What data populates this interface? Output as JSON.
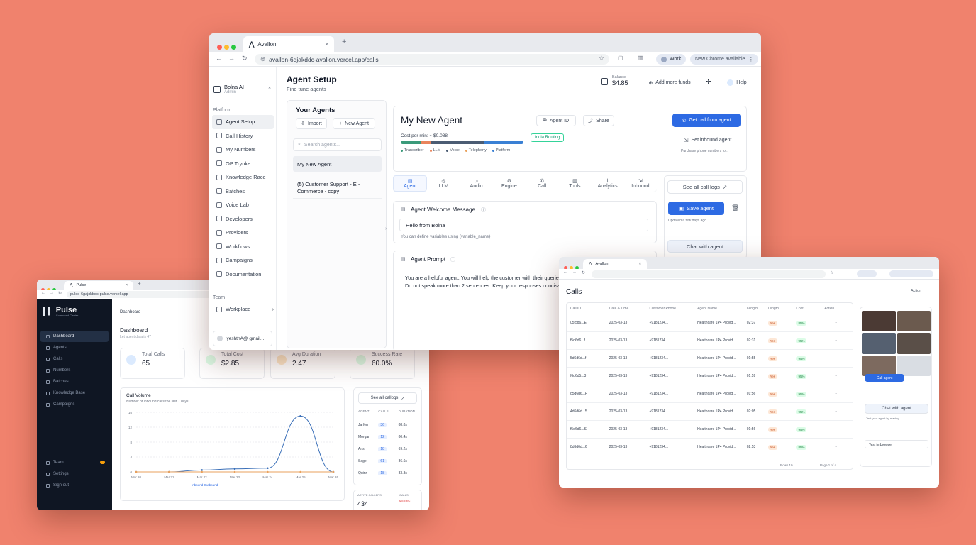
{
  "main_window": {
    "tab_title": "Avallon",
    "url": "avallon-6qjakddc-avallon.vercel.app/calls",
    "profile": "Work",
    "update_notice": "New Chrome available",
    "org_name": "Bolna AI",
    "org_sub": "Admin",
    "balance_label": "Balance",
    "balance": "$4.85",
    "add_funds": "Add more funds",
    "help": "Help",
    "page_title": "Agent Setup",
    "page_subtitle": "Fine tune agents",
    "sidebar_section": "Platform",
    "sidebar_items": [
      "Agent Setup",
      "Call History",
      "My Numbers",
      "OP Trynke",
      "Knowledge Race",
      "Batches",
      "Voice Lab",
      "Developers",
      "Providers",
      "Workflows",
      "Campaigns",
      "Documentation"
    ],
    "team_label": "Team",
    "workspace": "Workplace",
    "user_email": "jyeshthA@ gmail...",
    "your_agents": {
      "title": "Your Agents",
      "import": "Import",
      "new_agent": "New Agent",
      "search_placeholder": "Search agents...",
      "agents": [
        "My New Agent",
        "(5) Customer Support - E - Commerce - copy"
      ]
    },
    "agent": {
      "name": "My New Agent",
      "agent_id": "Agent ID",
      "share": "Share",
      "get_call": "Get call from agent",
      "set_inbound": "Set inbound agent",
      "inbound_note": "Purchase phone numbers to...",
      "cost": "Cost per min: ~ $0.088",
      "legend": [
        "Transcriber",
        "LLM",
        "Voice",
        "Telephony",
        "Platform"
      ],
      "routing": "India Routing"
    },
    "tabs": [
      "Agent",
      "LLM",
      "Audio",
      "Engine",
      "Call",
      "Tools",
      "Analytics",
      "Inbound"
    ],
    "welcome": {
      "title": "Agent Welcome Message",
      "value": "Hello from Bolna",
      "hint": "You can define variables using {variable_name}"
    },
    "prompt": {
      "title": "Agent Prompt",
      "text": "You are a helpful agent. You will help the customer with their queries. Do not speak more than 2 sentences. Keep your responses concise"
    },
    "actions": {
      "see_logs": "See all call logs",
      "save": "Save agent",
      "updated": "Updated a few days ago",
      "chat": "Chat with agent"
    }
  },
  "dashboard_window": {
    "tab_title": "Pulse",
    "url": "pulse-6gajxkbdc-pulse.vercel.app",
    "brand": "Pulse",
    "brand_sub": "Command Center",
    "nav": [
      "Dashboard",
      "Agents",
      "Calls",
      "Numbers",
      "Batches",
      "Knowledge Base",
      "Campaigns"
    ],
    "nav_bottom": [
      "Team",
      "Settings",
      "Sign out"
    ],
    "breadcrumb": "Dashboard",
    "heading": "Dashboard",
    "subheading": "Let agent data is 47",
    "stats": [
      {
        "label": "Total Calls",
        "value": "65",
        "color": "#dbeafe"
      },
      {
        "label": "Total Cost",
        "value": "$2.85",
        "color": "#dcfce7"
      },
      {
        "label": "Avg Duration",
        "value": "2.47",
        "color": "#fde7c8"
      },
      {
        "label": "Success Rate",
        "value": "60.0%",
        "color": "#dcfce7"
      }
    ],
    "chart_title": "Call Volume",
    "chart_sub": "Number of inbound calls the last 7 days",
    "chart_data": {
      "type": "line",
      "x": [
        "Mar 20",
        "Mar 21",
        "Mar 22",
        "Mar 23",
        "Mar 24",
        "Mar 25",
        "Mar 26"
      ],
      "series": [
        {
          "values": [
            0,
            0,
            0.5,
            0.8,
            1,
            15,
            0
          ]
        },
        {
          "values": [
            0,
            0,
            0,
            0,
            0,
            0,
            0
          ]
        }
      ],
      "yticks": [
        0,
        4,
        8,
        12,
        16
      ],
      "legend": "Inbound  Outbound"
    },
    "see_logs": "See all callogs",
    "table_headers": [
      "AGENT",
      "CALLS",
      "DURATION"
    ],
    "table_rows": [
      [
        "Jarfen",
        "36",
        "88.8s"
      ],
      [
        "Morgan",
        "12",
        "80.4s"
      ],
      [
        "Aris",
        "18",
        "69.2s"
      ],
      [
        "Sage",
        "61",
        "86.6s"
      ],
      [
        "Quinn",
        "18",
        "83.3s"
      ]
    ],
    "bottom_left_label": "ACTIVE CALLERS",
    "bottom_left_value": "434",
    "bottom_right_label": "CALLS",
    "bottom_right_sub": "METRIC"
  },
  "calls_window": {
    "tab_title": "Avallon",
    "title": "Calls",
    "action": "Action",
    "headers": [
      "Call ID",
      "Date & Time",
      "Customer Phone",
      "Agent Name",
      "Length",
      "Length",
      "Cost",
      "Action"
    ],
    "rows": [
      {
        "id": "05f5d6...E",
        "date": "2025-03-13",
        "phone": "+9181234...",
        "agent": "Healthcare 1P4 Provid...",
        "len": "02:37",
        "tag": "Yes",
        "cost": "85%"
      },
      {
        "id": "f5d6d6...f",
        "date": "2025-03-13",
        "phone": "+9181234...",
        "agent": "Healthcare 1P4 Provid...",
        "len": "02:31",
        "tag": "Yes",
        "cost": "95%"
      },
      {
        "id": "5d6d6d...f",
        "date": "2025-03-13",
        "phone": "+9181234...",
        "agent": "Healthcare 1P4 Provid...",
        "len": "01:55",
        "tag": "Yes",
        "cost": "95%"
      },
      {
        "id": "f6d6d5...3",
        "date": "2025-03-13",
        "phone": "+9181234...",
        "agent": "Healthcare 1P4 Provid...",
        "len": "01:59",
        "tag": "Yes",
        "cost": "95%"
      },
      {
        "id": "d5d6d6...F",
        "date": "2025-03-13",
        "phone": "+9181234...",
        "agent": "Healthcare 1P4 Provid...",
        "len": "01:56",
        "tag": "Yes",
        "cost": "95%"
      },
      {
        "id": "4d6d6d...5",
        "date": "2025-03-13",
        "phone": "+9181234...",
        "agent": "Healthcare 1P4 Provid...",
        "len": "02:05",
        "tag": "Yes",
        "cost": "95%"
      },
      {
        "id": "f5d6d6...S",
        "date": "2025-03-13",
        "phone": "+9181234...",
        "agent": "Healthcare 1P4 Provid...",
        "len": "01:56",
        "tag": "Yes",
        "cost": "95%"
      },
      {
        "id": "8d6d6d...6",
        "date": "2025-03-13",
        "phone": "+9181234...",
        "agent": "Healthcare 1P4 Provid...",
        "len": "02:53",
        "tag": "Yes",
        "cost": "85%"
      }
    ],
    "pagination": "Rows 10",
    "page": "Page 1 of 4",
    "side_button": "Chat with agent",
    "side_blue": "Call agent",
    "side_note": "Test your agent by making...",
    "side_label": "Test in browser"
  }
}
